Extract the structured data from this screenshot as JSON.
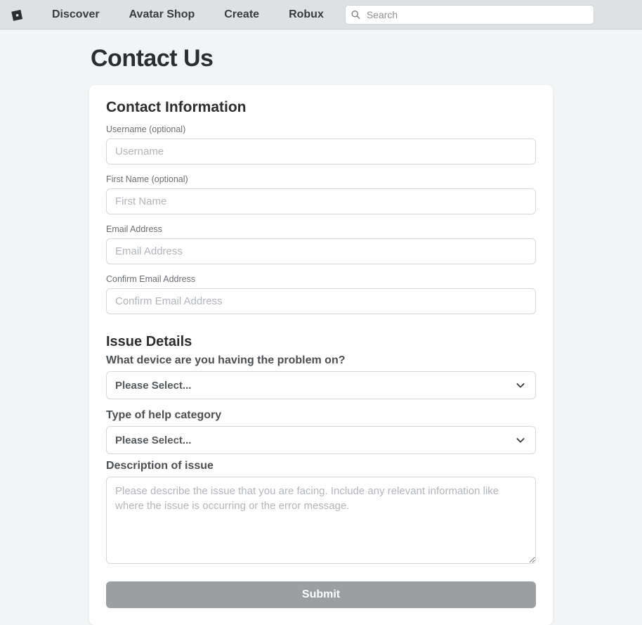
{
  "nav": {
    "items": [
      "Discover",
      "Avatar Shop",
      "Create",
      "Robux"
    ],
    "search_placeholder": "Search"
  },
  "page": {
    "title": "Contact Us"
  },
  "form": {
    "section_contact": "Contact Information",
    "username_label": "Username (optional)",
    "username_placeholder": "Username",
    "firstname_label": "First Name (optional)",
    "firstname_placeholder": "First Name",
    "email_label": "Email Address",
    "email_placeholder": "Email Address",
    "confirm_email_label": "Confirm Email Address",
    "confirm_email_placeholder": "Confirm Email Address",
    "section_issue": "Issue Details",
    "device_question": "What device are you having the problem on?",
    "device_selected": "Please Select...",
    "category_question": "Type of help category",
    "category_selected": "Please Select...",
    "description_label": "Description of issue",
    "description_placeholder": "Please describe the issue that you are facing. Include any relevant information like where the issue is occurring or the error message.",
    "submit_label": "Submit"
  }
}
